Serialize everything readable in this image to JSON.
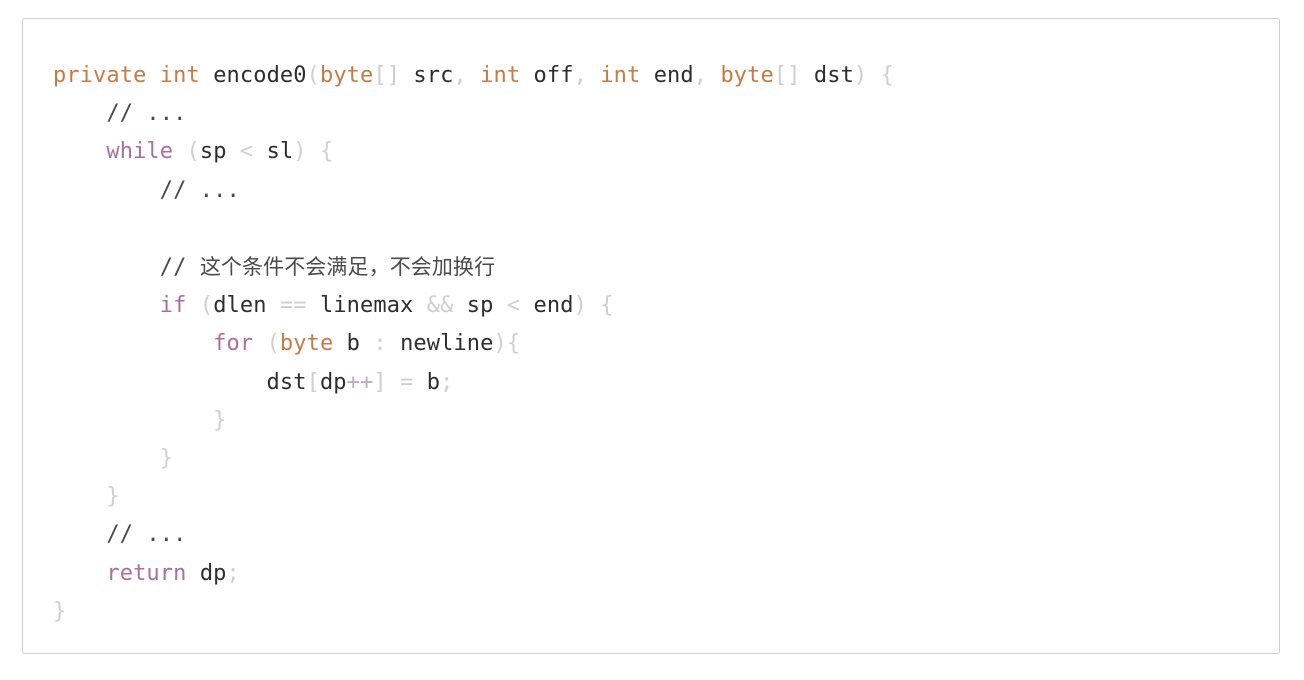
{
  "card": {
    "name": "code-snippet-card",
    "border_color": "#d0d0d0",
    "background": "#ffffff"
  },
  "theme": {
    "keyword_type_color": "#c87a45",
    "control_keyword_color": "#a96fa0",
    "identifier_color": "#2e2e2e",
    "punctuation_color": "#cfcfcf",
    "operator_color": "#c6a8c4",
    "comment_color": "#4a4a4a",
    "page_background": "#ffffff"
  },
  "code": {
    "language": "java",
    "full_text": "private int encode0(byte[] src, int off, int end, byte[] dst) {\n    // ...\n    while (sp < sl) {\n        // ...\n\n        // 这个条件不会满足，不会加换行\n        if (dlen == linemax && sp < end) {\n            for (byte b : newline){\n                dst[dp++] = b;\n            }\n        }\n    }\n    // ...\n    return dp;\n}",
    "lines": [
      {
        "n": 1,
        "text": "private int encode0(byte[] src, int off, int end, byte[] dst) {",
        "tokens": [
          {
            "t": "private",
            "c": "kw"
          },
          {
            "t": " ",
            "c": "id"
          },
          {
            "t": "int",
            "c": "kw"
          },
          {
            "t": " ",
            "c": "id"
          },
          {
            "t": "encode0",
            "c": "id"
          },
          {
            "t": "(",
            "c": "punc"
          },
          {
            "t": "byte",
            "c": "kw"
          },
          {
            "t": "[]",
            "c": "punc"
          },
          {
            "t": " src",
            "c": "id"
          },
          {
            "t": ", ",
            "c": "punc"
          },
          {
            "t": "int",
            "c": "kw"
          },
          {
            "t": " off",
            "c": "id"
          },
          {
            "t": ", ",
            "c": "punc"
          },
          {
            "t": "int",
            "c": "kw"
          },
          {
            "t": " end",
            "c": "id"
          },
          {
            "t": ", ",
            "c": "punc"
          },
          {
            "t": "byte",
            "c": "kw"
          },
          {
            "t": "[]",
            "c": "punc"
          },
          {
            "t": " dst",
            "c": "id"
          },
          {
            "t": ") {",
            "c": "punc"
          }
        ]
      },
      {
        "n": 2,
        "text": "    // ...",
        "tokens": [
          {
            "t": "    ",
            "c": "id"
          },
          {
            "t": "// ...",
            "c": "cmt"
          }
        ]
      },
      {
        "n": 3,
        "text": "    while (sp < sl) {",
        "tokens": [
          {
            "t": "    ",
            "c": "id"
          },
          {
            "t": "while",
            "c": "ctrl"
          },
          {
            "t": " ",
            "c": "id"
          },
          {
            "t": "(",
            "c": "punc"
          },
          {
            "t": "sp",
            "c": "id"
          },
          {
            "t": " < ",
            "c": "punc"
          },
          {
            "t": "sl",
            "c": "id"
          },
          {
            "t": ") {",
            "c": "punc"
          }
        ]
      },
      {
        "n": 4,
        "text": "        // ...",
        "tokens": [
          {
            "t": "        ",
            "c": "id"
          },
          {
            "t": "// ...",
            "c": "cmt"
          }
        ]
      },
      {
        "n": 5,
        "text": "",
        "tokens": []
      },
      {
        "n": 6,
        "text": "        // 这个条件不会满足，不会加换行",
        "tokens": [
          {
            "t": "        ",
            "c": "id"
          },
          {
            "t": "// ",
            "c": "cmt"
          },
          {
            "t": "这个条件不会满足，不会加换行",
            "c": "cmt-cn"
          }
        ]
      },
      {
        "n": 7,
        "text": "        if (dlen == linemax && sp < end) {",
        "tokens": [
          {
            "t": "        ",
            "c": "id"
          },
          {
            "t": "if",
            "c": "ctrl"
          },
          {
            "t": " ",
            "c": "id"
          },
          {
            "t": "(",
            "c": "punc"
          },
          {
            "t": "dlen",
            "c": "id"
          },
          {
            "t": " == ",
            "c": "punc"
          },
          {
            "t": "linemax",
            "c": "id"
          },
          {
            "t": " && ",
            "c": "punc"
          },
          {
            "t": "sp",
            "c": "id"
          },
          {
            "t": " < ",
            "c": "punc"
          },
          {
            "t": "end",
            "c": "id"
          },
          {
            "t": ") {",
            "c": "punc"
          }
        ]
      },
      {
        "n": 8,
        "text": "            for (byte b : newline){",
        "tokens": [
          {
            "t": "            ",
            "c": "id"
          },
          {
            "t": "for",
            "c": "ctrl"
          },
          {
            "t": " ",
            "c": "id"
          },
          {
            "t": "(",
            "c": "punc"
          },
          {
            "t": "byte",
            "c": "kw"
          },
          {
            "t": " b",
            "c": "id"
          },
          {
            "t": " : ",
            "c": "punc"
          },
          {
            "t": "newline",
            "c": "id"
          },
          {
            "t": "){",
            "c": "punc"
          }
        ]
      },
      {
        "n": 9,
        "text": "                dst[dp++] = b;",
        "tokens": [
          {
            "t": "                ",
            "c": "id"
          },
          {
            "t": "dst",
            "c": "id"
          },
          {
            "t": "[",
            "c": "punc"
          },
          {
            "t": "dp",
            "c": "id"
          },
          {
            "t": "++",
            "c": "op"
          },
          {
            "t": "]",
            "c": "punc"
          },
          {
            "t": " = ",
            "c": "punc"
          },
          {
            "t": "b",
            "c": "id"
          },
          {
            "t": ";",
            "c": "punc"
          }
        ]
      },
      {
        "n": 10,
        "text": "            }",
        "tokens": [
          {
            "t": "            ",
            "c": "id"
          },
          {
            "t": "}",
            "c": "punc"
          }
        ]
      },
      {
        "n": 11,
        "text": "        }",
        "tokens": [
          {
            "t": "        ",
            "c": "id"
          },
          {
            "t": "}",
            "c": "punc"
          }
        ]
      },
      {
        "n": 12,
        "text": "    }",
        "tokens": [
          {
            "t": "    ",
            "c": "id"
          },
          {
            "t": "}",
            "c": "punc"
          }
        ]
      },
      {
        "n": 13,
        "text": "    // ...",
        "tokens": [
          {
            "t": "    ",
            "c": "id"
          },
          {
            "t": "// ...",
            "c": "cmt"
          }
        ]
      },
      {
        "n": 14,
        "text": "    return dp;",
        "tokens": [
          {
            "t": "    ",
            "c": "id"
          },
          {
            "t": "return",
            "c": "ctrl"
          },
          {
            "t": " ",
            "c": "id"
          },
          {
            "t": "dp",
            "c": "id"
          },
          {
            "t": ";",
            "c": "punc"
          }
        ]
      },
      {
        "n": 15,
        "text": "}",
        "tokens": [
          {
            "t": "}",
            "c": "punc"
          }
        ]
      }
    ]
  }
}
